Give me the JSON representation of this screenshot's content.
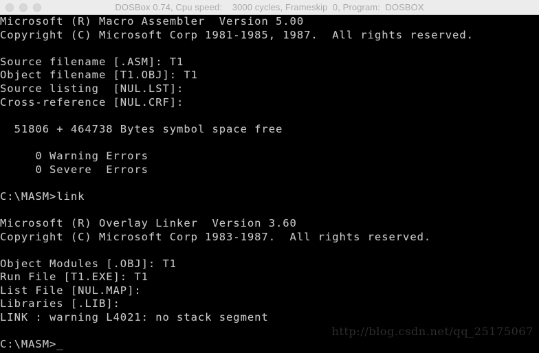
{
  "window": {
    "title": "DOSBox 0.74, Cpu speed:    3000 cycles, Frameskip  0, Program:  DOSBOX",
    "app_name": "DOSBOX",
    "traffic_lights": [
      {
        "name": "close-button",
        "label": "Close",
        "color": "#d8d8d8"
      },
      {
        "name": "minimize-button",
        "label": "Minimize",
        "color": "#d8d8d8"
      },
      {
        "name": "zoom-button",
        "label": "Zoom",
        "color": "#d8d8d8"
      }
    ],
    "titlebar_bg": "#ececec",
    "titlebar_fg": "#aaaaaa"
  },
  "terminal": {
    "bg": "#000000",
    "fg": "#c9c9c9",
    "prompt": "C:\\MASM>",
    "cursor": "_",
    "lines": [
      "Microsoft (R) Macro Assembler  Version 5.00",
      "Copyright (C) Microsoft Corp 1981-1985, 1987.  All rights reserved.",
      "",
      "Source filename [.ASM]: T1",
      "Object filename [T1.OBJ]: T1",
      "Source listing  [NUL.LST]:",
      "Cross-reference [NUL.CRF]:",
      "",
      "  51806 + 464738 Bytes symbol space free",
      "",
      "     0 Warning Errors",
      "     0 Severe  Errors",
      "",
      "C:\\MASM>link",
      "",
      "Microsoft (R) Overlay Linker  Version 3.60",
      "Copyright (C) Microsoft Corp 1983-1987.  All rights reserved.",
      "",
      "Object Modules [.OBJ]: T1",
      "Run File [T1.EXE]: T1",
      "List File [NUL.MAP]:",
      "Libraries [.LIB]:",
      "LINK : warning L4021: no stack segment",
      "",
      "C:\\MASM>_"
    ]
  },
  "watermark": {
    "text": "http://blog.csdn.net/qq_25175067",
    "color": "#2e2e2e"
  }
}
